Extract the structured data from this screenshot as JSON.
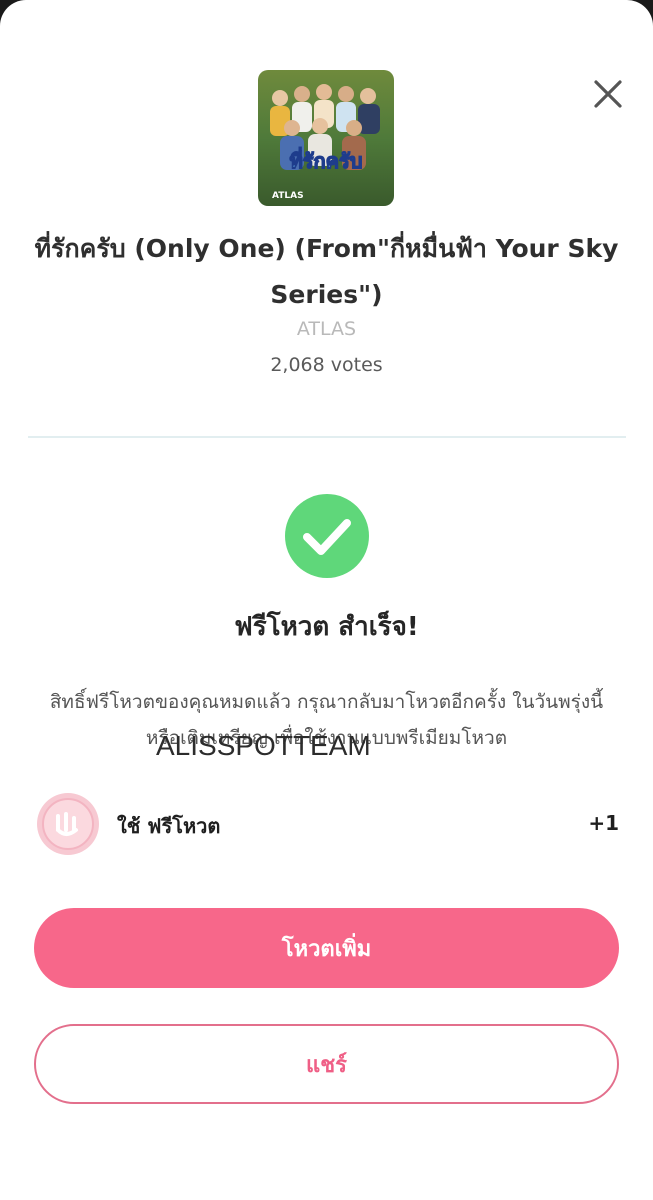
{
  "song": {
    "title": "ที่รักครับ (Only One) (From\"กี่หมื่นฟ้า Your Sky Series\")",
    "artist": "ATLAS",
    "votes": "2,068 votes",
    "album_art_text": "ATLAS",
    "album_art_script": "ที่รักครับ"
  },
  "result": {
    "title": "ฟรีโหวต สำเร็จ!",
    "message": "สิทธิ์ฟรีโหวตของคุณหมดแล้ว กรุณากลับมาโหวตอีกครั้ง ในวันพรุ่งนี้ หรือเติมเหรียญ เพื่อใช้งานแบบพรีเมียมโหวต",
    "watermark": "ALISSPOTTEAM"
  },
  "usage": {
    "label": "ใช้ ฟรีโหวต",
    "value": "+1"
  },
  "buttons": {
    "vote_more": "โหวตเพิ่ม",
    "share": "แชร์"
  },
  "icons": {
    "close": "close-icon",
    "check": "check-circle-icon",
    "coin": "free-vote-coin-icon"
  },
  "colors": {
    "accent": "#f7678a",
    "success": "#5fd77a",
    "outline": "#e36f8c"
  }
}
